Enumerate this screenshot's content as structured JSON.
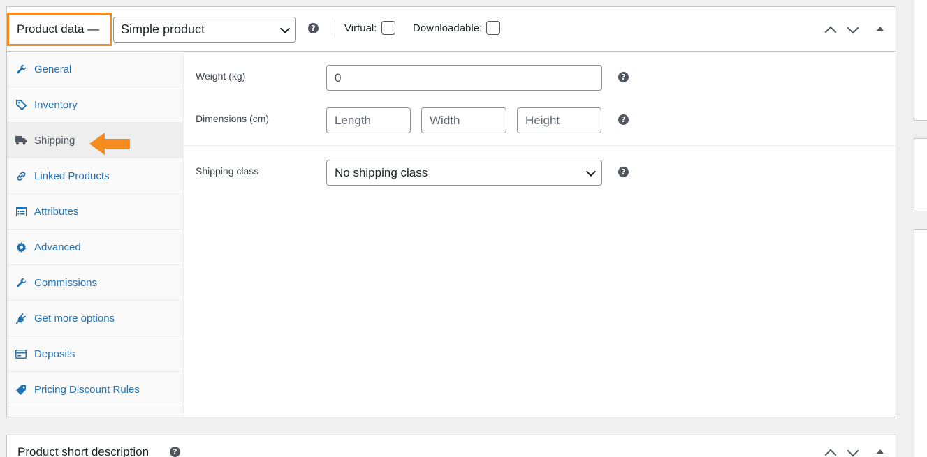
{
  "product_data": {
    "title": "Product data —",
    "product_type": "Simple product",
    "virtual_label": "Virtual:",
    "downloadable_label": "Downloadable:",
    "help_glyph": "?"
  },
  "tabs": [
    {
      "label": "General",
      "icon": "wrench-icon",
      "glyph": "🔧"
    },
    {
      "label": "Inventory",
      "icon": "tag-icon",
      "glyph": "◈"
    },
    {
      "label": "Shipping",
      "icon": "truck-icon",
      "glyph": "▪"
    },
    {
      "label": "Linked Products",
      "icon": "link-icon",
      "glyph": "🔗"
    },
    {
      "label": "Attributes",
      "icon": "list-icon",
      "glyph": "☰"
    },
    {
      "label": "Advanced",
      "icon": "gear-icon",
      "glyph": "⚙"
    },
    {
      "label": "Commissions",
      "icon": "wrench-icon",
      "glyph": "🔧"
    },
    {
      "label": "Get more options",
      "icon": "plugin-icon",
      "glyph": "⚡"
    },
    {
      "label": "Deposits",
      "icon": "card-icon",
      "glyph": "▭"
    },
    {
      "label": "Pricing Discount Rules",
      "icon": "tag-icon",
      "glyph": "◆"
    }
  ],
  "active_tab": "Shipping",
  "shipping": {
    "weight_label": "Weight (kg)",
    "weight_value": "0",
    "dimensions_label": "Dimensions (cm)",
    "length_placeholder": "Length",
    "width_placeholder": "Width",
    "height_placeholder": "Height",
    "shipping_class_label": "Shipping class",
    "shipping_class_value": "No shipping class"
  },
  "short_description": {
    "title": "Product short description"
  },
  "colors": {
    "highlight": "#f68b1f",
    "link": "#2271b1"
  }
}
